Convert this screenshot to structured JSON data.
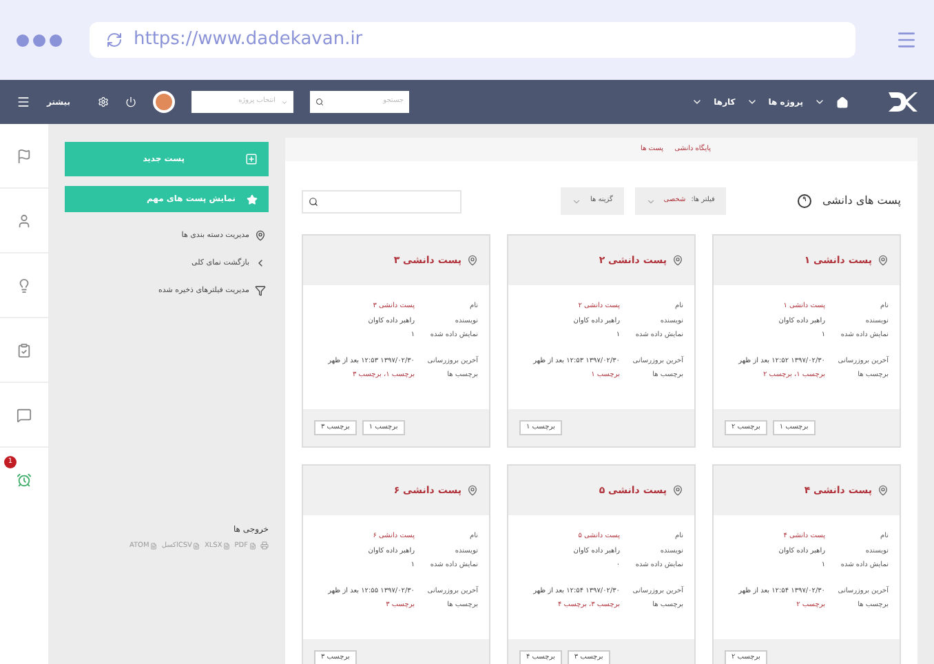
{
  "browser": {
    "url": "https://www.dadekavan.ir"
  },
  "navbar": {
    "more_label": "بیشتر",
    "project_select": {
      "placeholder": "انتخاب پروژه"
    },
    "search": {
      "placeholder": "جستجو"
    },
    "links": [
      {
        "label": "پروژه ها"
      },
      {
        "label": "کارها"
      }
    ]
  },
  "rail": {
    "alarm_badge": "1"
  },
  "sidebar": {
    "primary_buttons": [
      {
        "label": "پست جدید",
        "kind": "new"
      },
      {
        "label": "نمایش پست های مهم",
        "kind": "star"
      }
    ],
    "links": [
      {
        "label": "مدیریت دسته بندی ها",
        "kind": "pin"
      },
      {
        "label": "بازگشت نمای کلی",
        "kind": "back"
      },
      {
        "label": "مدیریت فیلترهای ذخیره شده",
        "kind": "filter"
      }
    ],
    "exports": {
      "title": "خروجی ها",
      "items": [
        "PDF",
        "XLSX",
        "CSVاکسل",
        "ATOM"
      ]
    }
  },
  "breadcrumb": [
    {
      "label": "پایگاه دانشی"
    },
    {
      "label": "پست ها"
    }
  ],
  "header": {
    "title": "پست های دانشی",
    "count": "۹"
  },
  "filters": {
    "label": "فیلتر ها:",
    "value": "شخصی"
  },
  "options": {
    "label": "گزینه ها"
  },
  "cards": [
    {
      "title": "پست دانشی ۱",
      "fields": [
        {
          "label": "نام",
          "value": "پست دانشی ۱",
          "kind": "link"
        },
        {
          "label": "نویسنده",
          "value": "راهبر داده کاوان",
          "kind": "text"
        },
        {
          "label": "نمایش داده شده",
          "value": "۱",
          "kind": "text"
        },
        {
          "label": "آخرین بروزرسانی",
          "value": "۱۳۹۷/۰۲/۳۰ ۱۲:۵۲ بعد از ظهر",
          "kind": "text"
        },
        {
          "label": "برچسب ها",
          "value": "برچسب ۱، برچسب ۲",
          "kind": "link"
        }
      ],
      "tags": [
        "برچسب ۱",
        "برچسب ۲"
      ]
    },
    {
      "title": "پست دانشی ۲",
      "fields": [
        {
          "label": "نام",
          "value": "پست دانشی ۲",
          "kind": "link"
        },
        {
          "label": "نویسنده",
          "value": "راهبر داده کاوان",
          "kind": "text"
        },
        {
          "label": "نمایش داده شده",
          "value": "۱",
          "kind": "text"
        },
        {
          "label": "آخرین بروزرسانی",
          "value": "۱۳۹۷/۰۲/۳۰ ۱۲:۵۳ بعد از ظهر",
          "kind": "text"
        },
        {
          "label": "برچسب ها",
          "value": "برچسب ۱",
          "kind": "link"
        }
      ],
      "tags": [
        "برچسب ۱"
      ]
    },
    {
      "title": "پست دانشی ۳",
      "fields": [
        {
          "label": "نام",
          "value": "پست دانشی ۳",
          "kind": "link"
        },
        {
          "label": "نویسنده",
          "value": "راهبر داده کاوان",
          "kind": "text"
        },
        {
          "label": "نمایش داده شده",
          "value": "۱",
          "kind": "text"
        },
        {
          "label": "آخرین بروزرسانی",
          "value": "۱۳۹۷/۰۲/۳۰ ۱۲:۵۳ بعد از ظهر",
          "kind": "text"
        },
        {
          "label": "برچسب ها",
          "value": "برچسب ۱، برچسب ۳",
          "kind": "link"
        }
      ],
      "tags": [
        "برچسب ۱",
        "برچسب ۳"
      ]
    },
    {
      "title": "پست دانشی ۴",
      "fields": [
        {
          "label": "نام",
          "value": "پست دانشی ۴",
          "kind": "link"
        },
        {
          "label": "نویسنده",
          "value": "راهبر داده کاوان",
          "kind": "text"
        },
        {
          "label": "نمایش داده شده",
          "value": "۱",
          "kind": "text"
        },
        {
          "label": "آخرین بروزرسانی",
          "value": "۱۳۹۷/۰۲/۳۰ ۱۲:۵۴ بعد از ظهر",
          "kind": "text"
        },
        {
          "label": "برچسب ها",
          "value": "برچسب ۲",
          "kind": "link"
        }
      ],
      "tags": [
        "برچسب ۲"
      ]
    },
    {
      "title": "پست دانشی ۵",
      "fields": [
        {
          "label": "نام",
          "value": "پست دانشی ۵",
          "kind": "link"
        },
        {
          "label": "نویسنده",
          "value": "راهبر داده کاوان",
          "kind": "text"
        },
        {
          "label": "نمایش داده شده",
          "value": "۰",
          "kind": "text"
        },
        {
          "label": "آخرین بروزرسانی",
          "value": "۱۳۹۷/۰۲/۳۰ ۱۲:۵۴ بعد از ظهر",
          "kind": "text"
        },
        {
          "label": "برچسب ها",
          "value": "برچسب ۳، برچسب ۴",
          "kind": "link"
        }
      ],
      "tags": [
        "برچسب ۳",
        "برچسب ۴"
      ]
    },
    {
      "title": "پست دانشی ۶",
      "fields": [
        {
          "label": "نام",
          "value": "پست دانشی ۶",
          "kind": "link"
        },
        {
          "label": "نویسنده",
          "value": "راهبر داده کاوان",
          "kind": "text"
        },
        {
          "label": "نمایش داده شده",
          "value": "۱",
          "kind": "text"
        },
        {
          "label": "آخرین بروزرسانی",
          "value": "۱۳۹۷/۰۲/۳۰ ۱۲:۵۵ بعد از ظهر",
          "kind": "text"
        },
        {
          "label": "برچسب ها",
          "value": "برچسب ۳",
          "kind": "link"
        }
      ],
      "tags": [
        "برچسب ۳"
      ]
    }
  ]
}
